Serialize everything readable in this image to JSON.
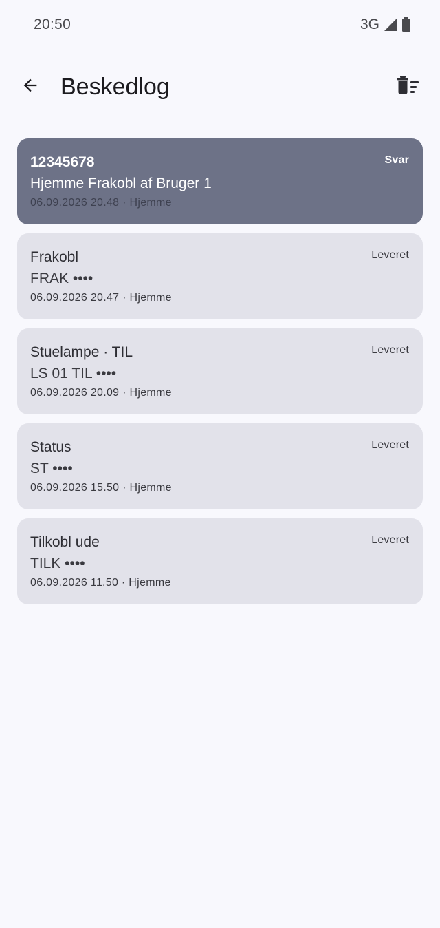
{
  "status_bar": {
    "time": "20:50",
    "network": "3G",
    "signal_icon": "cell-signal-icon",
    "battery_icon": "battery-icon"
  },
  "app_bar": {
    "back_icon": "arrow-back-icon",
    "title": "Beskedlog",
    "delete_icon": "delete-sweep-icon"
  },
  "colors": {
    "background": "#f8f8fd",
    "card": "#e2e2ea",
    "card_highlight": "#6d7287"
  },
  "messages": [
    {
      "title": "12345678",
      "body": "Hjemme Frakobl af Bruger 1",
      "meta": "06.09.2026 20.48 · Hjemme",
      "status": "Svar"
    },
    {
      "title": "Frakobl",
      "body": "FRAK ••••",
      "meta": "06.09.2026 20.47 · Hjemme",
      "status": "Leveret"
    },
    {
      "title": "Stuelampe · TIL",
      "body": "LS 01 TIL ••••",
      "meta": "06.09.2026 20.09 · Hjemme",
      "status": "Leveret"
    },
    {
      "title": "Status",
      "body": "ST ••••",
      "meta": "06.09.2026 15.50 · Hjemme",
      "status": "Leveret"
    },
    {
      "title": "Tilkobl ude",
      "body": "TILK ••••",
      "meta": "06.09.2026 11.50 · Hjemme",
      "status": "Leveret"
    }
  ]
}
